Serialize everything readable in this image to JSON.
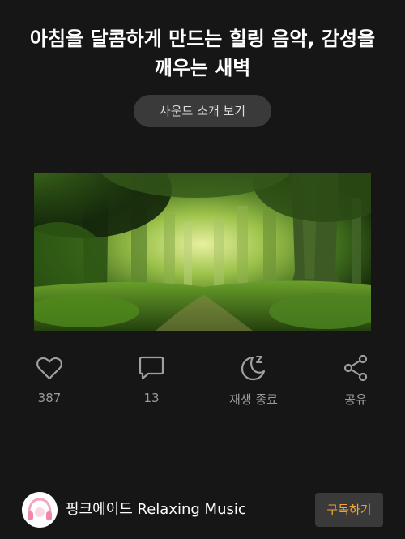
{
  "header": {
    "title": "아침을 달콤하게 만드는 힐링 음악, 감성을 깨우는 새벽"
  },
  "intro_button_label": "사운드 소개 보기",
  "actions": {
    "like": {
      "icon": "heart-icon",
      "count": "387"
    },
    "comment": {
      "icon": "comment-icon",
      "count": "13"
    },
    "sleep_timer": {
      "icon": "moon-sleep-icon",
      "label": "재생 종료"
    },
    "share": {
      "icon": "share-icon",
      "label": "공유"
    }
  },
  "channel": {
    "name": "핑크에이드 Relaxing Music",
    "subscribe_label": "구독하기"
  },
  "colors": {
    "background": "#161616",
    "accent": "#f4a52e",
    "button_bg": "#3a3a3a",
    "muted_text": "#9a9a9a"
  }
}
